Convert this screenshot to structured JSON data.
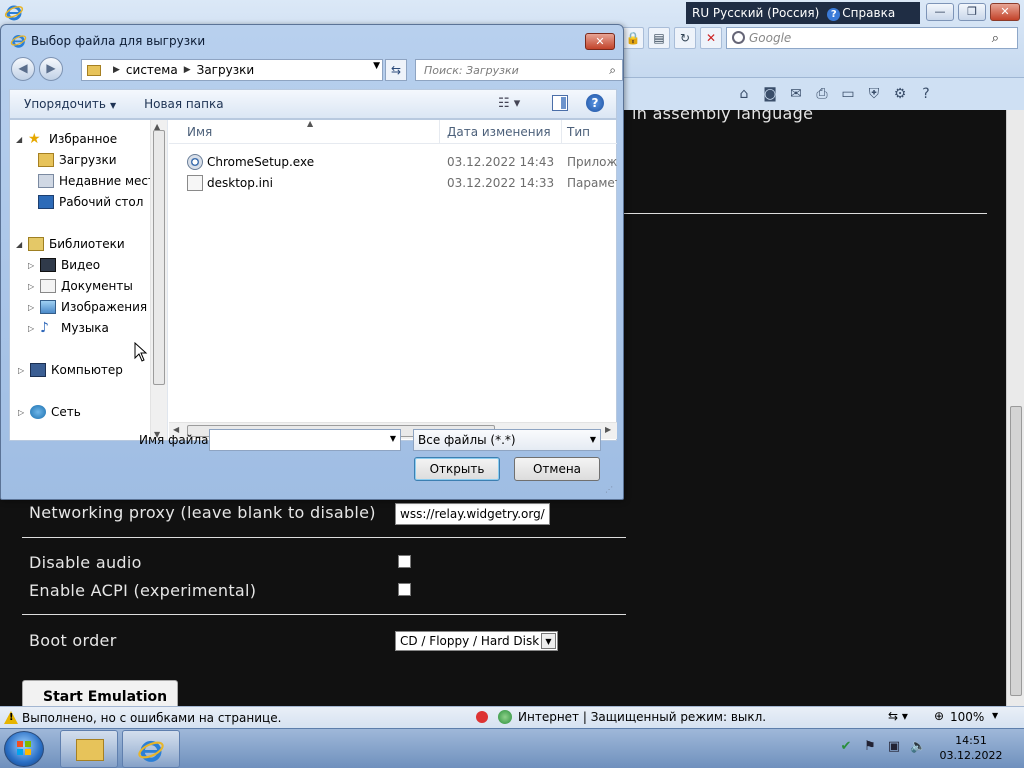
{
  "browser": {
    "lang_indicator": "RU Русский (Россия)",
    "help_label": "Справка",
    "search_placeholder": "Google",
    "page_text_fragment": "in assembly language"
  },
  "page": {
    "proxy_label": "Networking proxy (leave blank to disable)",
    "proxy_value": "wss://relay.widgetry.org/",
    "disable_audio_label": "Disable audio",
    "acpi_label": "Enable ACPI (experimental)",
    "boot_order_label": "Boot order",
    "boot_order_value": "CD / Floppy / Hard Disk",
    "start_button": "Start Emulation"
  },
  "statusbar": {
    "status_text": "Выполнено, но с ошибками на странице.",
    "zone_text": "Интернет | Защищенный режим: выкл.",
    "zoom": "100%"
  },
  "taskbar": {
    "time": "14:51",
    "date": "03.12.2022"
  },
  "dialog": {
    "title": "Выбор файла для выгрузки",
    "breadcrumb": [
      "система",
      "Загрузки"
    ],
    "search_placeholder": "Поиск: Загрузки",
    "toolbar": {
      "organize": "Упорядочить",
      "new_folder": "Новая папка"
    },
    "nav": {
      "favorites": "Избранное",
      "downloads": "Загрузки",
      "recent": "Недавние места",
      "desktop": "Рабочий стол",
      "libraries": "Библиотеки",
      "video": "Видео",
      "documents": "Документы",
      "images": "Изображения",
      "music": "Музыка",
      "computer": "Компьютер",
      "network": "Сеть"
    },
    "columns": {
      "name": "Имя",
      "date": "Дата изменения",
      "type": "Тип"
    },
    "files": [
      {
        "name": "ChromeSetup.exe",
        "date": "03.12.2022 14:43",
        "type": "Приложе"
      },
      {
        "name": "desktop.ini",
        "date": "03.12.2022 14:33",
        "type": "Параметр"
      }
    ],
    "filename_label": "Имя файла:",
    "filename_value": "",
    "filetype_value": "Все файлы (*.*)",
    "open_button": "Открыть",
    "cancel_button": "Отмена"
  }
}
